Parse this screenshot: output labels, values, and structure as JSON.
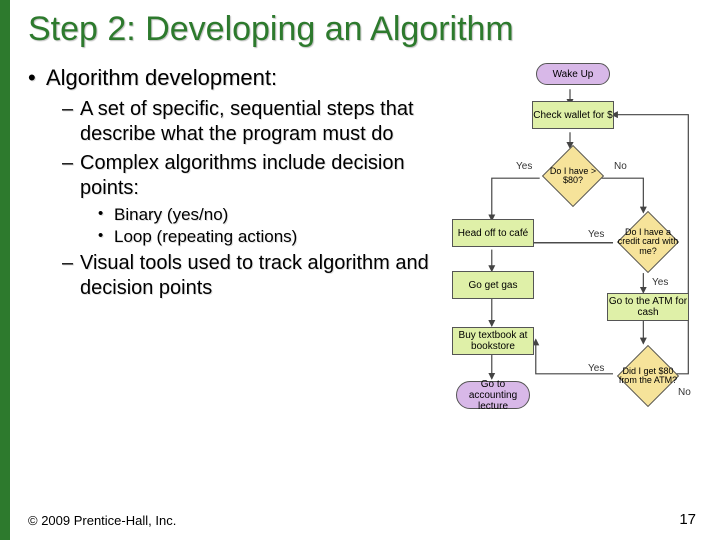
{
  "title": "Step 2: Developing an Algorithm",
  "bullets": {
    "l1": "Algorithm development:",
    "l2a": "A set of specific, sequential steps that describe what the program must do",
    "l2b": "Complex algorithms include decision points:",
    "l3a": "Binary (yes/no)",
    "l3b": "Loop (repeating actions)",
    "l2c": "Visual tools used to track algorithm and decision points"
  },
  "flowchart": {
    "start": "Wake Up",
    "p1": "Check wallet for $",
    "d1": "Do I have > $80?",
    "d2": "Do I have a credit card with me?",
    "p2": "Head off to café",
    "p3": "Go get gas",
    "p4": "Go to the ATM for cash",
    "p5": "Buy textbook at bookstore",
    "d3": "Did I get $80 from the ATM?",
    "end": "Go to accounting lecture",
    "yes": "Yes",
    "no": "No"
  },
  "footer": {
    "copyright": "© 2009 Prentice-Hall, Inc.",
    "page": "17"
  }
}
